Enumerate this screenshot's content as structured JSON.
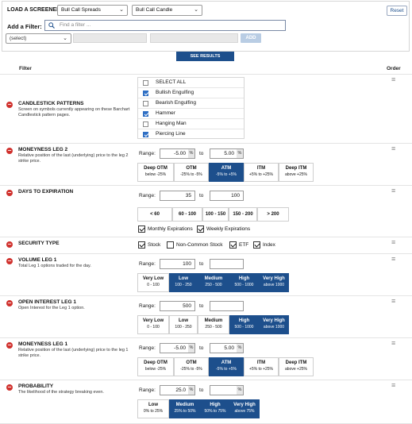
{
  "header": {
    "load_label": "LOAD A SCREENER:",
    "screener_select": "Bull Call Spreads",
    "candle_select": "Bull Call Candle",
    "reset_label": "Reset",
    "add_filter_label": "Add a Filter:",
    "find_placeholder": "Find a filter ...",
    "select_placeholder": "(select)",
    "add_label": "ADD"
  },
  "see_results_label": "SEE RESULTS",
  "table_header": {
    "filter": "Filter",
    "order": "Order"
  },
  "filters": {
    "candlestick": {
      "title": "CANDLESTICK PATTERNS",
      "desc": "Screen on symbols currently appearing on these Barchart Candlestick pattern pages.",
      "items": [
        {
          "label": "SELECT ALL",
          "checked": false
        },
        {
          "label": "Bullish Engulfing",
          "checked": true
        },
        {
          "label": "Bearish Engulfing",
          "checked": false
        },
        {
          "label": "Hammer",
          "checked": true
        },
        {
          "label": "Hanging Man",
          "checked": false
        },
        {
          "label": "Piercing Line",
          "checked": true
        }
      ]
    },
    "moneyness2": {
      "title": "MONEYNESS LEG 2",
      "desc": "Relative position of the last (underlying) price to the leg 2 strike price.",
      "range_label": "Range:",
      "from": "-5.00",
      "to": "5.00",
      "to_label": "to",
      "pct": "%",
      "segments": [
        {
          "t": "Deep OTM",
          "s": "below -25%"
        },
        {
          "t": "OTM",
          "s": "-25% to -5%"
        },
        {
          "t": "ATM",
          "s": "-5% to +5%"
        },
        {
          "t": "ITM",
          "s": "+5% to +25%"
        },
        {
          "t": "Deep ITM",
          "s": "above +25%"
        }
      ]
    },
    "dte": {
      "title": "DAYS TO EXPIRATION",
      "range_label": "Range:",
      "from": "35",
      "to": "100",
      "to_label": "to",
      "segments": [
        "< 60",
        "60 - 100",
        "100 - 150",
        "150 - 200",
        "> 200"
      ],
      "monthly": "Monthly Expirations",
      "weekly": "Weekly Expirations"
    },
    "security": {
      "title": "SECURITY TYPE",
      "stock": "Stock",
      "noncommon": "Non-Common Stock",
      "etf": "ETF",
      "index": "Index"
    },
    "volume": {
      "title": "VOLUME LEG 1",
      "desc": "Total Leg 1 options traded for the day.",
      "range_label": "Range:",
      "from": "100",
      "to": "",
      "to_label": "to",
      "segments": [
        {
          "t": "Very Low",
          "s": "0 - 100"
        },
        {
          "t": "Low",
          "s": "100 - 250"
        },
        {
          "t": "Medium",
          "s": "250 - 500"
        },
        {
          "t": "High",
          "s": "500 - 1000"
        },
        {
          "t": "Very High",
          "s": "above 1000"
        }
      ]
    },
    "oi": {
      "title": "OPEN INTEREST LEG 1",
      "desc": "Open Interest for the Leg 1 option.",
      "range_label": "Range:",
      "from": "500",
      "to": "",
      "to_label": "to",
      "segments": [
        {
          "t": "Very Low",
          "s": "0 - 100"
        },
        {
          "t": "Low",
          "s": "100 - 250"
        },
        {
          "t": "Medium",
          "s": "250 - 500"
        },
        {
          "t": "High",
          "s": "500 - 1000"
        },
        {
          "t": "Very High",
          "s": "above 1000"
        }
      ]
    },
    "moneyness1": {
      "title": "MONEYNESS LEG 1",
      "desc": "Relative position of the last (underlying) price to the leg 1 strike price.",
      "range_label": "Range:",
      "from": "-5.00",
      "to": "5.00",
      "to_label": "to",
      "pct": "%",
      "segments": [
        {
          "t": "Deep OTM",
          "s": "below -25%"
        },
        {
          "t": "OTM",
          "s": "-25% to -5%"
        },
        {
          "t": "ATM",
          "s": "-5% to +5%"
        },
        {
          "t": "ITM",
          "s": "+5% to +25%"
        },
        {
          "t": "Deep ITM",
          "s": "above +25%"
        }
      ]
    },
    "probability": {
      "title": "PROBABILITY",
      "desc": "The likelihood of the strategy breaking even.",
      "range_label": "Range:",
      "from": "25.0",
      "to": "",
      "to_label": "to",
      "pct": "%",
      "segments": [
        {
          "t": "Low",
          "s": "0% to 25%"
        },
        {
          "t": "Medium",
          "s": "25% to 50%"
        },
        {
          "t": "High",
          "s": "50% to 75%"
        },
        {
          "t": "Very High",
          "s": "above 75%"
        }
      ]
    }
  },
  "icons": {
    "remove": "minus-circle-icon",
    "drag": "hamburger-icon",
    "search": "search-icon",
    "dropdown": "chevron-down-icon"
  },
  "colors": {
    "accent": "#1d4f8c",
    "remove": "#d0312d",
    "checkbox": "#2f6fc4"
  }
}
